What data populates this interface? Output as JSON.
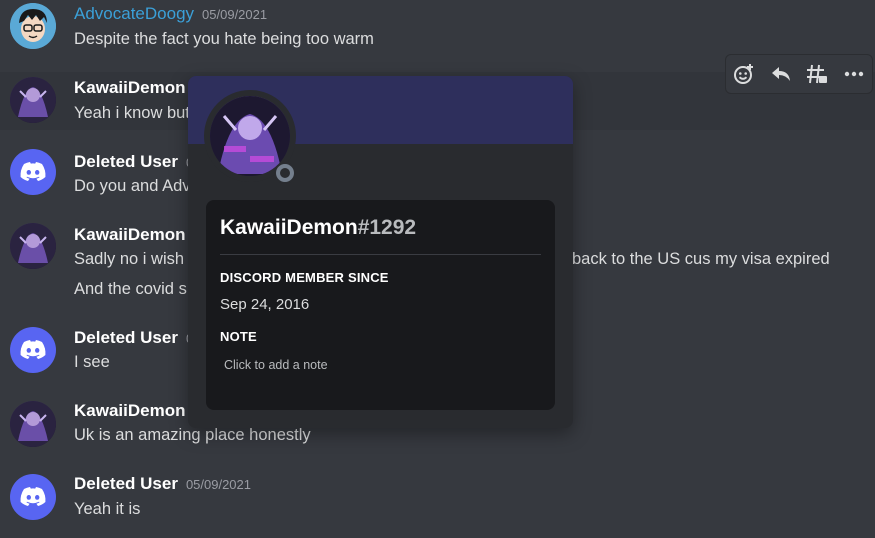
{
  "messages": [
    {
      "author": "AdvocateDoogy",
      "timestamp": "05/09/2021",
      "text": "Despite the fact you hate being too warm"
    },
    {
      "author": "KawaiiDemon",
      "timestamp": "",
      "text": "Yeah i know but"
    },
    {
      "author": "Deleted User",
      "timestamp": "0",
      "text": "Do you and Adv"
    },
    {
      "author": "KawaiiDemon",
      "timestamp": "",
      "text": "Sadly no i wish",
      "text_right": "back to the US cus my visa expired",
      "text2": "And the covid s"
    },
    {
      "author": "Deleted User",
      "timestamp": "0",
      "text": "I see"
    },
    {
      "author": "KawaiiDemon",
      "timestamp": "",
      "text": "Uk is an amazing place honestly"
    },
    {
      "author": "Deleted User",
      "timestamp": "05/09/2021",
      "text": "Yeah it is"
    }
  ],
  "toolbar": {
    "icons": [
      "add-reaction-icon",
      "reply-icon",
      "create-thread-icon",
      "more-options-icon"
    ]
  },
  "popout": {
    "username": "KawaiiDemon",
    "discriminator": "#1292",
    "member_since_label": "DISCORD MEMBER SINCE",
    "member_since": "Sep 24, 2016",
    "note_label": "NOTE",
    "note_placeholder": "Click to add a note",
    "status": "offline"
  },
  "colors": {
    "background": "#36393f",
    "popout": "#292b2f",
    "banner": "#2e2f5c",
    "blurple": "#5865f2",
    "link_name": "#3ba0d8"
  }
}
